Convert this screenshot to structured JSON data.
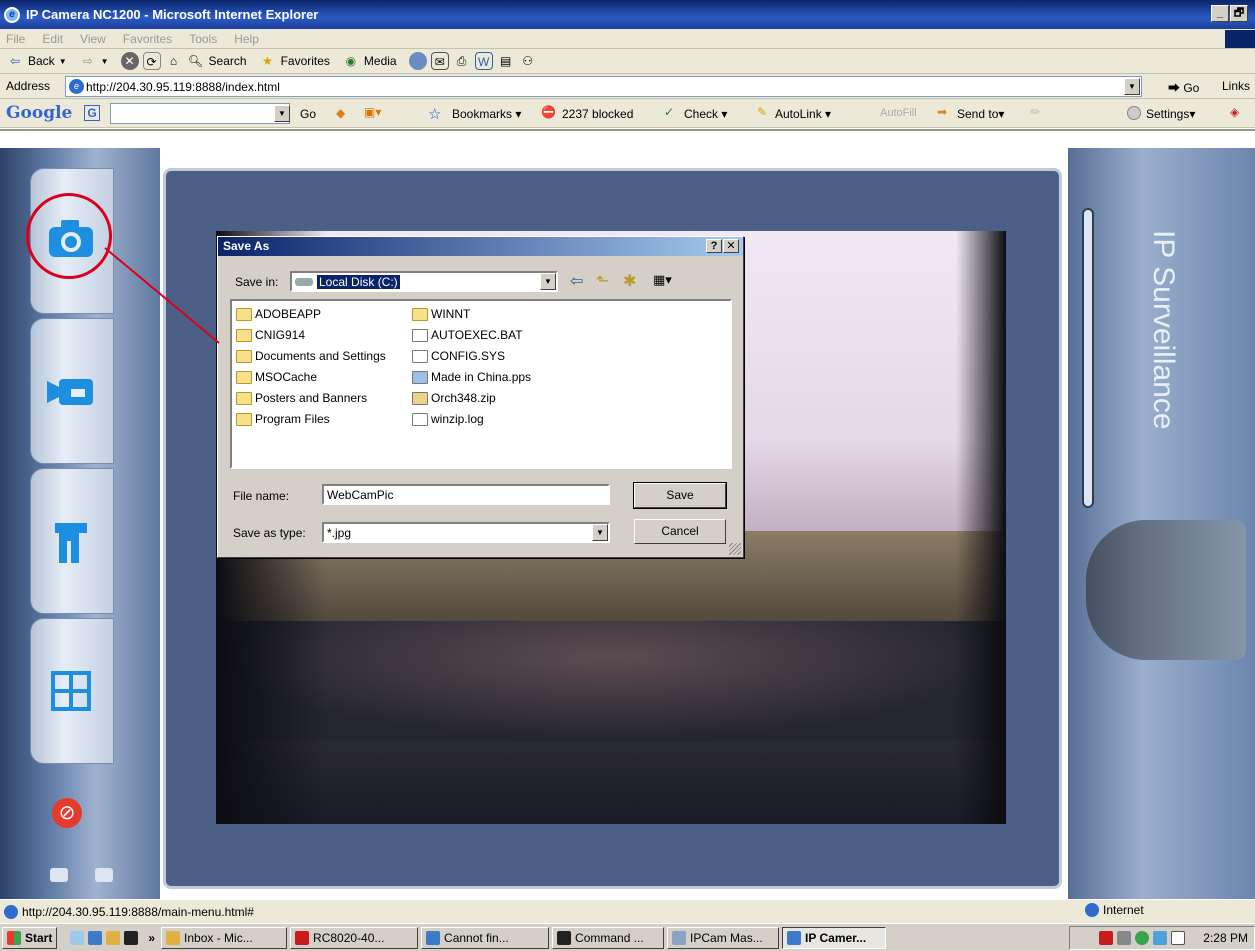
{
  "window": {
    "title": "IP Camera NC1200 - Microsoft Internet Explorer",
    "min": "_",
    "restore": "🗗"
  },
  "menu": [
    "File",
    "Edit",
    "View",
    "Favorites",
    "Tools",
    "Help"
  ],
  "toolbar": {
    "back": "Back",
    "search": "Search",
    "favorites": "Favorites",
    "media": "Media"
  },
  "address": {
    "label": "Address",
    "url": "http://204.30.95.119:8888/index.html",
    "go": "Go",
    "links": "Links"
  },
  "google": {
    "logo": "Google",
    "go": "Go",
    "bookmarks": "Bookmarks",
    "blocked": "2237 blocked",
    "check": "Check",
    "autolink": "AutoLink",
    "autofill": "AutoFill",
    "sendto": "Send to",
    "settings": "Settings"
  },
  "brand": {
    "side_text": "IP Surveillance"
  },
  "dialog": {
    "title": "Save As",
    "help": "?",
    "close": "✕",
    "save_in_label": "Save in:",
    "save_in_value": "Local Disk (C:)",
    "files_col1": [
      "ADOBEAPP",
      "CNIG914",
      "Documents and Settings",
      "MSOCache",
      "Posters and Banners",
      "Program Files"
    ],
    "files_col2": [
      "WINNT",
      "AUTOEXEC.BAT",
      "CONFIG.SYS",
      "Made in China.pps",
      "Orch348.zip",
      "winzip.log"
    ],
    "file_name_label": "File name:",
    "file_name_value": "WebCamPic",
    "type_label": "Save as type:",
    "type_value": "*.jpg",
    "save_button": "Save",
    "cancel_button": "Cancel"
  },
  "status": {
    "url": "http://204.30.95.119:8888/main-menu.html#",
    "zone": "Internet"
  },
  "taskbar": {
    "start": "Start",
    "items": [
      "Inbox - Mic...",
      "RC8020-40...",
      "Cannot fin...",
      "Command ...",
      "IPCam Mas...",
      "IP Camer..."
    ],
    "clock": "2:28 PM"
  },
  "colors": {
    "accent": "#0a246a",
    "annotation": "#d9001b"
  }
}
